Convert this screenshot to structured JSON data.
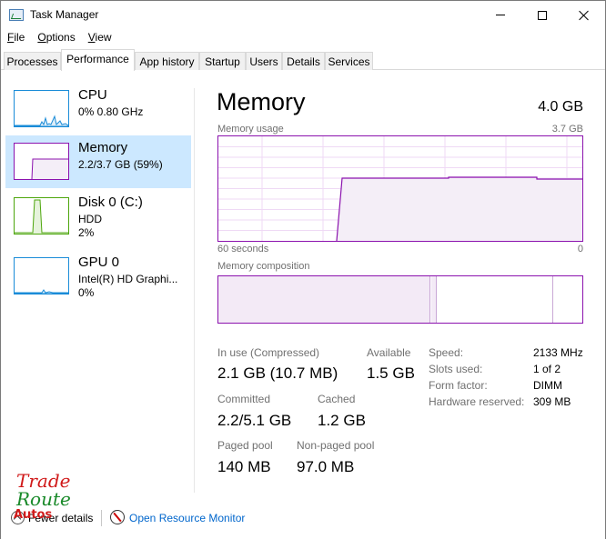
{
  "window": {
    "title": "Task Manager"
  },
  "window_controls": {
    "minimize": "minimize-button",
    "maximize": "maximize-button",
    "close": "close-button"
  },
  "menu": {
    "items": [
      {
        "label_u": "F",
        "label_rest": "ile"
      },
      {
        "label_u": "O",
        "label_rest": "ptions"
      },
      {
        "label_u": "V",
        "label_rest": "iew"
      }
    ]
  },
  "tabs": [
    {
      "label": "Processes"
    },
    {
      "label": "Performance"
    },
    {
      "label": "App history"
    },
    {
      "label": "Startup"
    },
    {
      "label": "Users"
    },
    {
      "label": "Details"
    },
    {
      "label": "Services"
    }
  ],
  "active_tab": "Performance",
  "resources": [
    {
      "name": "CPU",
      "sub1": "0%  0.80 GHz",
      "sub2": "",
      "color": "#1a8cd8"
    },
    {
      "name": "Memory",
      "sub1": "2.2/3.7 GB (59%)",
      "sub2": "",
      "color": "#8b12ae"
    },
    {
      "name": "Disk 0 (C:)",
      "sub1": "HDD",
      "sub2": "2%",
      "color": "#4da60c"
    },
    {
      "name": "GPU 0",
      "sub1": "Intel(R) HD Graphi...",
      "sub2": "0%",
      "color": "#1a8cd8"
    }
  ],
  "selected_resource": "Memory",
  "memory": {
    "title": "Memory",
    "total": "4.0 GB",
    "usage_label": "Memory usage",
    "usage_max": "3.7 GB",
    "time_left": "60 seconds",
    "time_right": "0",
    "usage_fraction": 0.59,
    "composition_label": "Memory composition",
    "stats": {
      "in_use_label": "In use (Compressed)",
      "in_use_value": "2.1 GB (10.7 MB)",
      "available_label": "Available",
      "available_value": "1.5 GB",
      "committed_label": "Committed",
      "committed_value": "2.2/5.1 GB",
      "cached_label": "Cached",
      "cached_value": "1.2 GB",
      "paged_label": "Paged pool",
      "paged_value": "140 MB",
      "nonpaged_label": "Non-paged pool",
      "nonpaged_value": "97.0 MB"
    },
    "details": [
      {
        "label": "Speed:",
        "value": "2133 MHz"
      },
      {
        "label": "Slots used:",
        "value": "1 of 2"
      },
      {
        "label": "Form factor:",
        "value": "DIMM"
      },
      {
        "label": "Hardware reserved:",
        "value": "309 MB"
      }
    ]
  },
  "footer": {
    "fewer_details": "Fewer details",
    "resource_monitor": "Open Resource Monitor"
  },
  "logo": {
    "line1": "Trade",
    "line2": "Route",
    "line3": "Autos"
  },
  "colors": {
    "memory": "#8b12ae",
    "memory_fill": "#f4eef7",
    "selected_bg": "#cce8ff",
    "link": "#0066cc"
  }
}
